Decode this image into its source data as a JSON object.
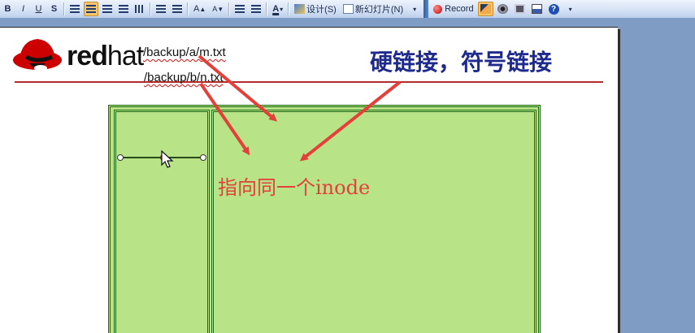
{
  "toolbar": {
    "items": {
      "bold": "B",
      "italic": "I",
      "underline": "U",
      "shadow": "S",
      "font_color_letter": "A",
      "grow_font": "A",
      "shrink_font": "A",
      "design_label": "设计(S)",
      "new_slide_label": "新幻灯片(N)",
      "record_label": "Record",
      "help_label": "?"
    }
  },
  "slide": {
    "logo": {
      "brand_bold": "red",
      "brand_thin": "hat"
    },
    "title": "硬链接，符号链接",
    "path_1": "/backup/a/m.txt",
    "path_2": "/backup/b/n.txt",
    "inode_text": "指向同一个inode"
  },
  "colors": {
    "title_blue": "#1e2a8c",
    "arrow_red": "#e3403a",
    "green_fill": "#b8e387",
    "green_border": "#1f6a15",
    "toolbar_bg": "#d6e2f5",
    "workspace_bg": "#7f9cc4"
  }
}
